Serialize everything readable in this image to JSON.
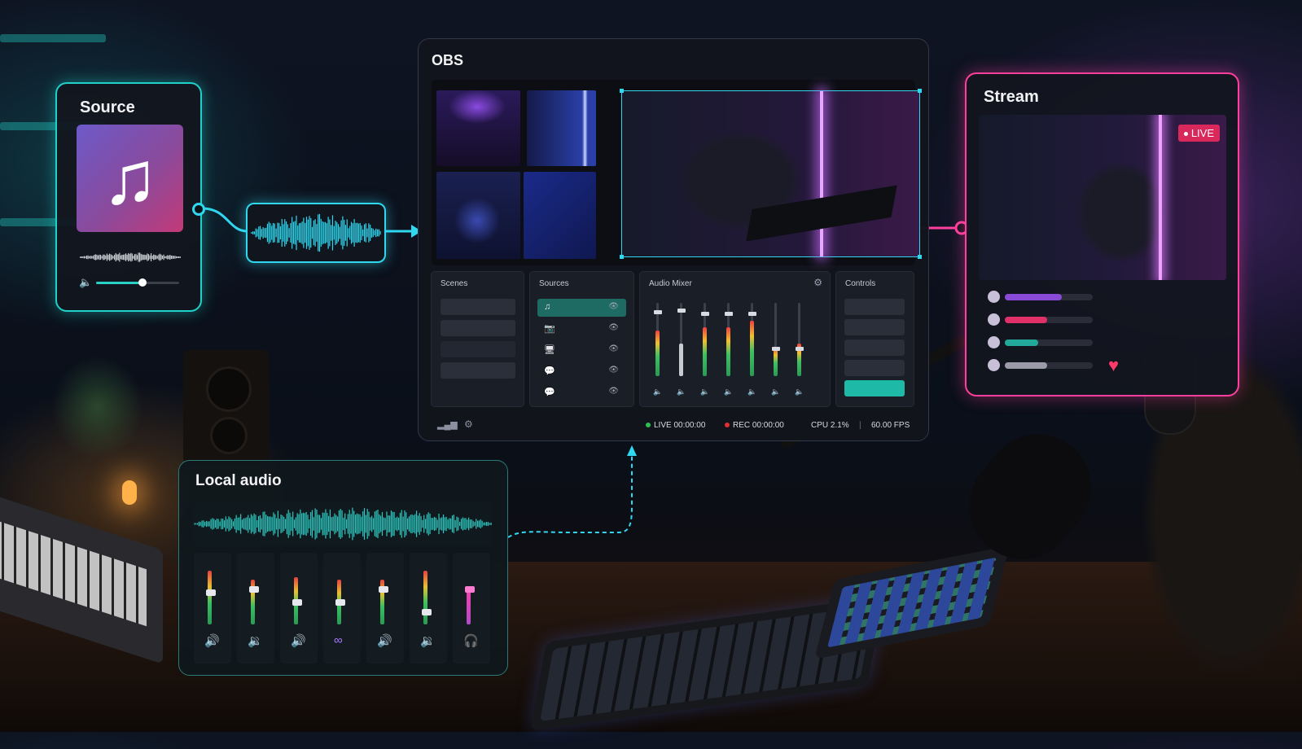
{
  "source": {
    "title": "Source",
    "music_icon": "music-note-icon",
    "volume_fraction": 0.56
  },
  "obs": {
    "title": "OBS",
    "scenes_title": "Scenes",
    "sources_title": "Sources",
    "audio_mixer_title": "Audio Mixer",
    "controls_title": "Controls",
    "source_rows": [
      {
        "icon": "music-icon",
        "glyph": "♫",
        "active": true
      },
      {
        "icon": "camera-icon",
        "glyph": "📷",
        "active": false
      },
      {
        "icon": "monitor-icon",
        "glyph": "🖥",
        "active": false
      },
      {
        "icon": "chat-icon",
        "glyph": "💬",
        "active": false
      },
      {
        "icon": "chat-icon",
        "glyph": "💬",
        "active": false
      }
    ],
    "mixer_levels": [
      0.55,
      0.35,
      0.6,
      0.6,
      0.7,
      0.3,
      0.35
    ],
    "fader_levels": [
      0.9,
      0.92,
      0.88,
      0.88,
      0.88,
      0.4,
      0.4
    ],
    "status": {
      "live": "LIVE 00:00:00",
      "rec": "REC 00:00:00",
      "cpu": "CPU 2.1%",
      "fps": "60.00 FPS"
    }
  },
  "stream": {
    "title": "Stream",
    "live_badge": "LIVE",
    "chat_bars": [
      {
        "fraction": 0.65,
        "color": "#8a4ad8"
      },
      {
        "fraction": 0.48,
        "color": "#e0306a"
      },
      {
        "fraction": 0.38,
        "color": "#22a89a"
      },
      {
        "fraction": 0.48,
        "color": "#9a9aa8"
      }
    ]
  },
  "local_audio": {
    "title": "Local audio",
    "channels": [
      {
        "level": 0.85,
        "knob": 0.55,
        "icon": "speaker-icon",
        "glyph": "🔊",
        "style": "normal"
      },
      {
        "level": 0.7,
        "knob": 0.6,
        "icon": "speaker-icon",
        "glyph": "🔉",
        "style": "teal"
      },
      {
        "level": 0.75,
        "knob": 0.4,
        "icon": "speaker-icon",
        "glyph": "🔊",
        "style": "normal"
      },
      {
        "level": 0.7,
        "knob": 0.4,
        "icon": "link-icon",
        "glyph": "∞",
        "style": "purple"
      },
      {
        "level": 0.7,
        "knob": 0.6,
        "icon": "speaker-icon",
        "glyph": "🔊",
        "style": "normal"
      },
      {
        "level": 0.85,
        "knob": 0.25,
        "icon": "speaker-icon",
        "glyph": "🔉",
        "style": "normal"
      },
      {
        "level": 0.6,
        "knob": 0.6,
        "icon": "headphones-icon",
        "glyph": "🎧",
        "style": "pink"
      }
    ]
  },
  "colors": {
    "teal": "#1fd1c8",
    "cyan": "#2fd8ef",
    "pink": "#ff3f9e",
    "live_red": "#d8285c"
  }
}
